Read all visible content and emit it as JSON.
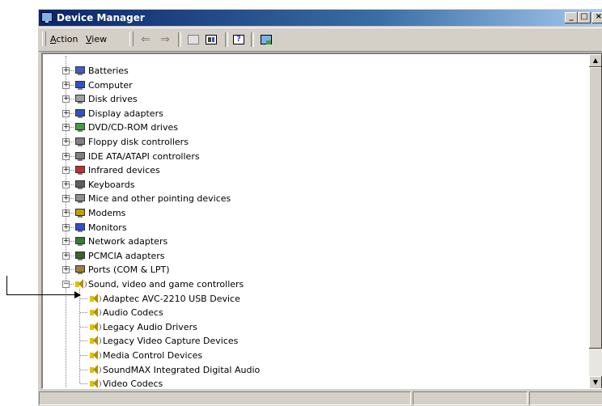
{
  "window": {
    "title": "Device Manager"
  },
  "title_buttons": {
    "minimize": "_",
    "maximize": "□",
    "close": "×"
  },
  "menu": {
    "action": {
      "mnemonic": "A",
      "rest": "ction"
    },
    "view": {
      "mnemonic": "V",
      "rest": "iew"
    }
  },
  "toolbar": [
    "back-arrow",
    "forward-arrow",
    "up-icon",
    "properties-icon",
    "help-icon",
    "scan-hardware-icon"
  ],
  "tree": {
    "categories": [
      {
        "label": "Batteries",
        "icon": "battery-icon",
        "color": "#4060c0"
      },
      {
        "label": "Computer",
        "icon": "computer-icon",
        "color": "#3050d0"
      },
      {
        "label": "Disk drives",
        "icon": "disk-drive-icon",
        "color": "#a0a0a0"
      },
      {
        "label": "Display adapters",
        "icon": "display-adapter-icon",
        "color": "#3050d0"
      },
      {
        "label": "DVD/CD-ROM drives",
        "icon": "cdrom-icon",
        "color": "#40a040"
      },
      {
        "label": "Floppy disk controllers",
        "icon": "floppy-controller-icon",
        "color": "#808080"
      },
      {
        "label": "IDE ATA/ATAPI controllers",
        "icon": "ide-controller-icon",
        "color": "#808080"
      },
      {
        "label": "Infrared devices",
        "icon": "infrared-icon",
        "color": "#c03030"
      },
      {
        "label": "Keyboards",
        "icon": "keyboard-icon",
        "color": "#606060"
      },
      {
        "label": "Mice and other pointing devices",
        "icon": "mouse-icon",
        "color": "#909090"
      },
      {
        "label": "Modems",
        "icon": "modem-icon",
        "color": "#c0a000"
      },
      {
        "label": "Monitors",
        "icon": "monitor-icon",
        "color": "#3050d0"
      },
      {
        "label": "Network adapters",
        "icon": "network-adapter-icon",
        "color": "#308030"
      },
      {
        "label": "PCMCIA adapters",
        "icon": "pcmcia-icon",
        "color": "#406030"
      },
      {
        "label": "Ports (COM & LPT)",
        "icon": "ports-icon",
        "color": "#a08040"
      },
      {
        "label": "Sound, video and game controllers",
        "icon": "sound-icon",
        "color": "#e0c000"
      }
    ],
    "children": [
      "Adaptec AVC-2210 USB Device",
      "Audio Codecs",
      "Legacy Audio Drivers",
      "Legacy Video Capture Devices",
      "Media Control Devices",
      "SoundMAX Integrated Digital Audio",
      "Video Codecs"
    ],
    "expander_plus": "+",
    "expander_minus": "−"
  },
  "scrollbar": {
    "up": "▲",
    "down": "▼"
  },
  "accent": "#0a246a"
}
